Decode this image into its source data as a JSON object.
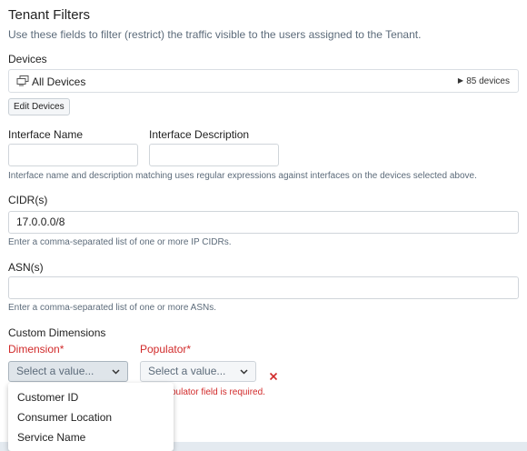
{
  "header": {
    "title": "Tenant Filters",
    "subtitle": "Use these fields to filter (restrict) the traffic visible to the users assigned to the Tenant."
  },
  "devices": {
    "label": "Devices",
    "selection": "All Devices",
    "count": "85 devices",
    "edit_button": "Edit Devices",
    "icon": "devices-icon"
  },
  "interface": {
    "name_label": "Interface Name",
    "name_value": "",
    "description_label": "Interface Description",
    "description_value": "",
    "help": "Interface name and description matching uses regular expressions against interfaces on the devices selected above."
  },
  "cidr": {
    "label": "CIDR(s)",
    "value": "17.0.0.0/8",
    "help": "Enter a comma-separated list of one or more IP CIDRs."
  },
  "asn": {
    "label": "ASN(s)",
    "value": "",
    "help": "Enter a comma-separated list of one or more ASNs."
  },
  "custom_dimensions": {
    "label": "Custom Dimensions",
    "dimension_label": "Dimension*",
    "dimension_placeholder": "Select a value...",
    "populator_label": "Populator*",
    "populator_placeholder": "Select a value...",
    "error_text": "pulator field is required.",
    "remove_icon": "close-icon",
    "error_color": "#d12a2a",
    "dropdown_options": [
      "Customer ID",
      "Consumer Location",
      "Service Name"
    ]
  }
}
